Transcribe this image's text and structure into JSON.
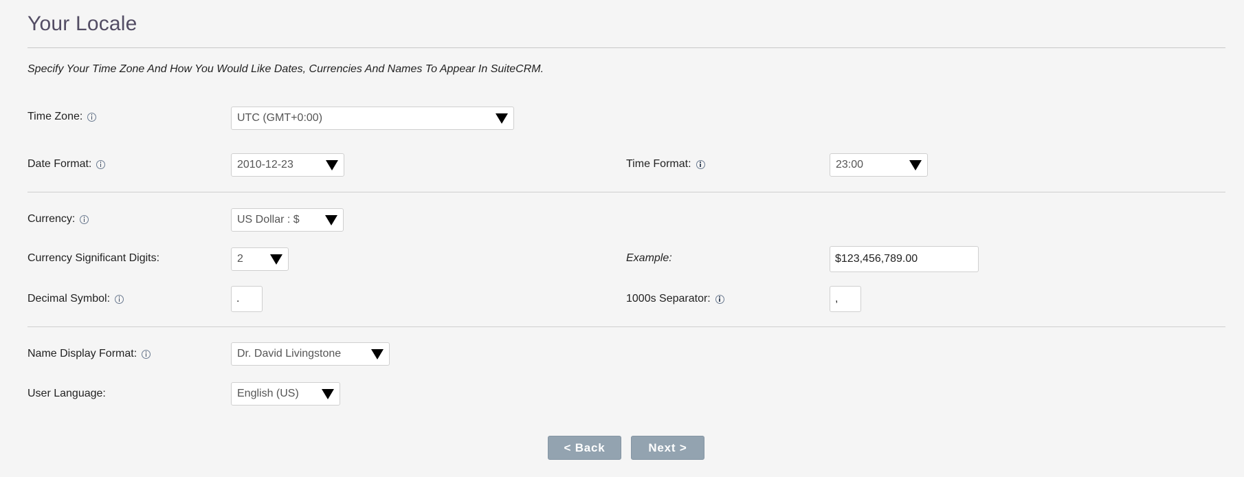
{
  "page": {
    "title": "Your Locale",
    "intro": "Specify Your Time Zone And How You Would Like Dates, Currencies And Names To Appear In SuiteCRM."
  },
  "fields": {
    "time_zone": {
      "label": "Time Zone:",
      "value": "UTC (GMT+0:00)"
    },
    "date_format": {
      "label": "Date Format:",
      "value": "2010-12-23"
    },
    "time_format": {
      "label": "Time Format:",
      "value": "23:00"
    },
    "currency": {
      "label": "Currency:",
      "value": "US Dollar : $"
    },
    "significant_digits": {
      "label": "Currency Significant Digits:",
      "value": "2"
    },
    "example": {
      "label": "Example:",
      "value": "$123,456,789.00"
    },
    "decimal_symbol": {
      "label": "Decimal Symbol:",
      "value": "."
    },
    "thousands_separator": {
      "label": "1000s Separator:",
      "value": ","
    },
    "name_format": {
      "label": "Name Display Format:",
      "value": "Dr. David Livingstone"
    },
    "user_language": {
      "label": "User Language:",
      "value": "English (US)"
    }
  },
  "buttons": {
    "back": "< Back",
    "next": "Next >"
  },
  "icons": {
    "info": "info-icon",
    "dropdown": "triangle-down-icon"
  },
  "colors": {
    "title": "#534d64",
    "button_bg": "#93a3b0",
    "page_bg": "#f5f5f5"
  }
}
